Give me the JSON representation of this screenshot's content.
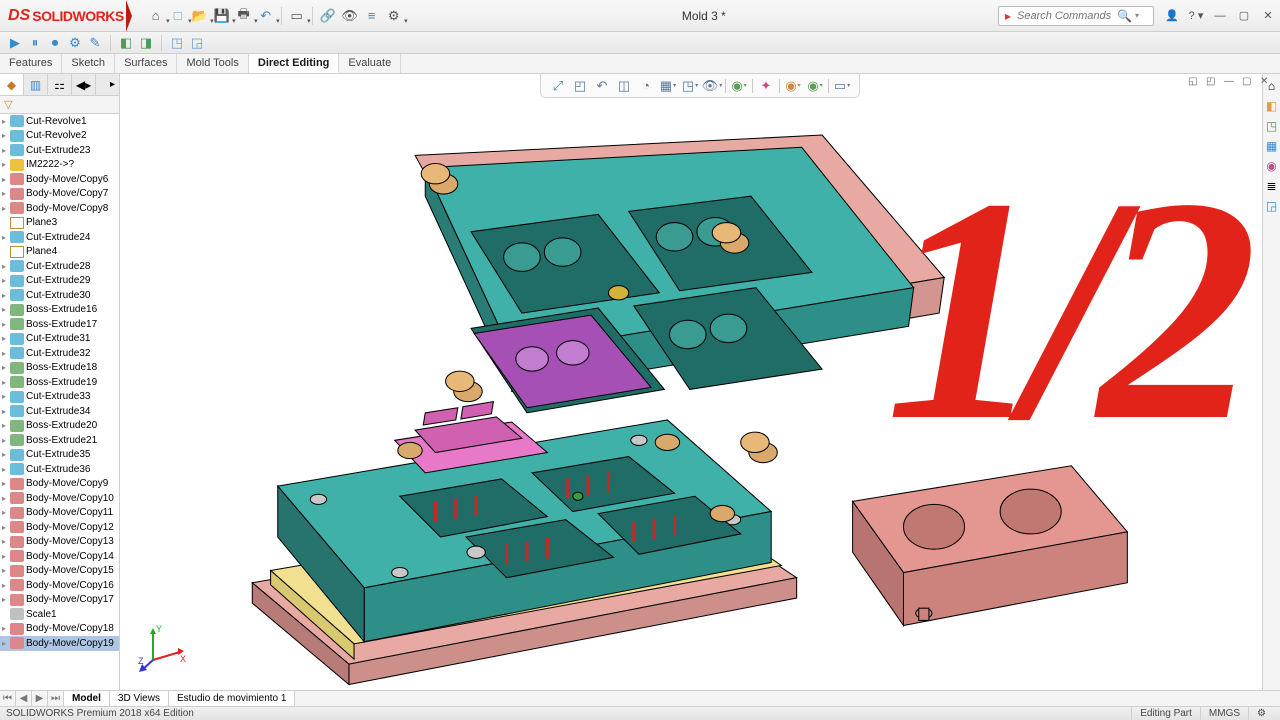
{
  "app": {
    "name": "SOLIDWORKS",
    "doc_title": "Mold 3 *"
  },
  "search": {
    "placeholder": "Search Commands"
  },
  "quick_toolbar": [
    "home",
    "doc-new",
    "open",
    "save",
    "print",
    "undo",
    "select",
    "link",
    "eye",
    "rebuild",
    "options"
  ],
  "cmd_manager_tabs": [
    "Features",
    "Sketch",
    "Surfaces",
    "Mold Tools",
    "Direct Editing",
    "Evaluate"
  ],
  "cmd_manager_active": 4,
  "overlay": "1/2",
  "tree": [
    {
      "icon": "cut",
      "label": "Cut-Revolve1",
      "exp": true
    },
    {
      "icon": "cut",
      "label": "Cut-Revolve2",
      "exp": true
    },
    {
      "icon": "cut",
      "label": "Cut-Extrude23",
      "exp": true
    },
    {
      "icon": "im",
      "label": "IM2222->?",
      "exp": true
    },
    {
      "icon": "move",
      "label": "Body-Move/Copy6",
      "exp": true
    },
    {
      "icon": "move",
      "label": "Body-Move/Copy7",
      "exp": true
    },
    {
      "icon": "move",
      "label": "Body-Move/Copy8",
      "exp": true
    },
    {
      "icon": "plane",
      "label": "Plane3",
      "exp": false
    },
    {
      "icon": "cut",
      "label": "Cut-Extrude24",
      "exp": true
    },
    {
      "icon": "plane",
      "label": "Plane4",
      "exp": false
    },
    {
      "icon": "cut",
      "label": "Cut-Extrude28",
      "exp": true
    },
    {
      "icon": "cut",
      "label": "Cut-Extrude29",
      "exp": true
    },
    {
      "icon": "cut",
      "label": "Cut-Extrude30",
      "exp": true
    },
    {
      "icon": "boss",
      "label": "Boss-Extrude16",
      "exp": true
    },
    {
      "icon": "boss",
      "label": "Boss-Extrude17",
      "exp": true
    },
    {
      "icon": "cut",
      "label": "Cut-Extrude31",
      "exp": true
    },
    {
      "icon": "cut",
      "label": "Cut-Extrude32",
      "exp": true
    },
    {
      "icon": "boss",
      "label": "Boss-Extrude18",
      "exp": true
    },
    {
      "icon": "boss",
      "label": "Boss-Extrude19",
      "exp": true
    },
    {
      "icon": "cut",
      "label": "Cut-Extrude33",
      "exp": true
    },
    {
      "icon": "cut",
      "label": "Cut-Extrude34",
      "exp": true
    },
    {
      "icon": "boss",
      "label": "Boss-Extrude20",
      "exp": true
    },
    {
      "icon": "boss",
      "label": "Boss-Extrude21",
      "exp": true
    },
    {
      "icon": "cut",
      "label": "Cut-Extrude35",
      "exp": true
    },
    {
      "icon": "cut",
      "label": "Cut-Extrude36",
      "exp": true
    },
    {
      "icon": "move",
      "label": "Body-Move/Copy9",
      "exp": true
    },
    {
      "icon": "move",
      "label": "Body-Move/Copy10",
      "exp": true
    },
    {
      "icon": "move",
      "label": "Body-Move/Copy11",
      "exp": true
    },
    {
      "icon": "move",
      "label": "Body-Move/Copy12",
      "exp": true
    },
    {
      "icon": "move",
      "label": "Body-Move/Copy13",
      "exp": true
    },
    {
      "icon": "move",
      "label": "Body-Move/Copy14",
      "exp": true
    },
    {
      "icon": "move",
      "label": "Body-Move/Copy15",
      "exp": true
    },
    {
      "icon": "move",
      "label": "Body-Move/Copy16",
      "exp": true
    },
    {
      "icon": "move",
      "label": "Body-Move/Copy17",
      "exp": true
    },
    {
      "icon": "scale",
      "label": "Scale1",
      "exp": false
    },
    {
      "icon": "move",
      "label": "Body-Move/Copy18",
      "exp": true
    },
    {
      "icon": "move",
      "label": "Body-Move/Copy19",
      "exp": true,
      "selected": true
    }
  ],
  "bottom_tabs": [
    "Model",
    "3D Views",
    "Estudio de movimiento 1"
  ],
  "bottom_active": 0,
  "status": {
    "left": "SOLIDWORKS Premium 2018 x64 Edition",
    "mode": "Editing Part",
    "units": "MMGS"
  }
}
